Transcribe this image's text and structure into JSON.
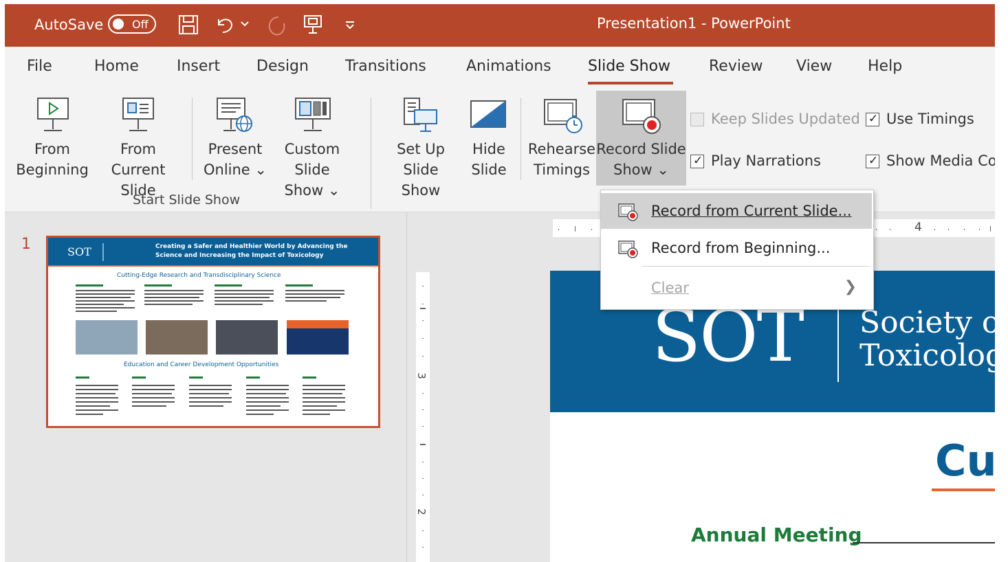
{
  "title_bar": {
    "autosave_label": "AutoSave",
    "autosave_state": "Off",
    "title": "Presentation1  -  PowerPoint",
    "bg_color": "#b7472a"
  },
  "tabs": [
    "File",
    "Home",
    "Insert",
    "Design",
    "Transitions",
    "Animations",
    "Slide Show",
    "Review",
    "View",
    "Help"
  ],
  "active_tab": "Slide Show",
  "ribbon": {
    "from_beginning": [
      "From",
      "Beginning"
    ],
    "from_current": [
      "From",
      "Current Slide"
    ],
    "present_online": [
      "Present",
      "Online ⌄"
    ],
    "custom_show": [
      "Custom Slide",
      "Show ⌄"
    ],
    "group_start": "Start Slide Show",
    "setup": [
      "Set Up",
      "Slide Show"
    ],
    "hide": [
      "Hide",
      "Slide"
    ],
    "rehearse": [
      "Rehearse",
      "Timings"
    ],
    "record": [
      "Record Slide",
      "Show ⌄"
    ],
    "keep_updated": "Keep Slides Updated",
    "use_timings": "Use Timings",
    "play_narrations": "Play Narrations",
    "show_media": "Show Media Co"
  },
  "dropdown": {
    "record_current": "Record from Current Slide...",
    "record_beginning": "Record from Beginning...",
    "clear": "Clear"
  },
  "thumbnail": {
    "slide_number": "1",
    "header_title": "Creating a Safer and Healthier World by Advancing the Science and Increasing the Impact of Toxicology",
    "logo": "SOT",
    "section1": "Cutting-Edge Research and Transdisciplinary Science",
    "section2": "Education and Career Development Opportunities"
  },
  "slide": {
    "logo": "SOT",
    "society_line1": "Society o",
    "society_line2": "Toxicolog",
    "heading_partial": "Cu",
    "annual_meeting": "Annual Meeting"
  },
  "rulers": {
    "h_mark": "4",
    "v_marks": [
      "3",
      "2"
    ]
  },
  "colors": {
    "accent": "#b7472a",
    "sot_blue": "#0b5f95",
    "annual_green": "#1e7b3a",
    "orange_line": "#e8622b"
  }
}
